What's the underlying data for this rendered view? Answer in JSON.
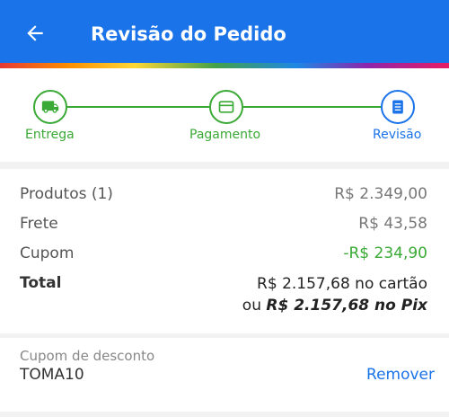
{
  "header": {
    "title": "Revisão do Pedido"
  },
  "steps": [
    {
      "label": "Entrega",
      "icon": "truck-icon",
      "state": "done"
    },
    {
      "label": "Pagamento",
      "icon": "credit-card-icon",
      "state": "done"
    },
    {
      "label": "Revisão",
      "icon": "document-icon",
      "state": "active"
    }
  ],
  "summary": {
    "products_label": "Produtos (1)",
    "products_value": "R$ 2.349,00",
    "shipping_label": "Frete",
    "shipping_value": "R$ 43,58",
    "coupon_label": "Cupom",
    "coupon_value": "-R$ 234,90",
    "total_label": "Total",
    "total_card": "R$ 2.157,68 no cartão",
    "total_pix_prefix": "ou",
    "total_pix_value": "R$ 2.157,68 no Pix"
  },
  "coupon": {
    "caption": "Cupom de desconto",
    "code": "TOMA10",
    "remove_label": "Remover"
  },
  "colors": {
    "primary": "#1a73e8",
    "success": "#3aa935"
  }
}
